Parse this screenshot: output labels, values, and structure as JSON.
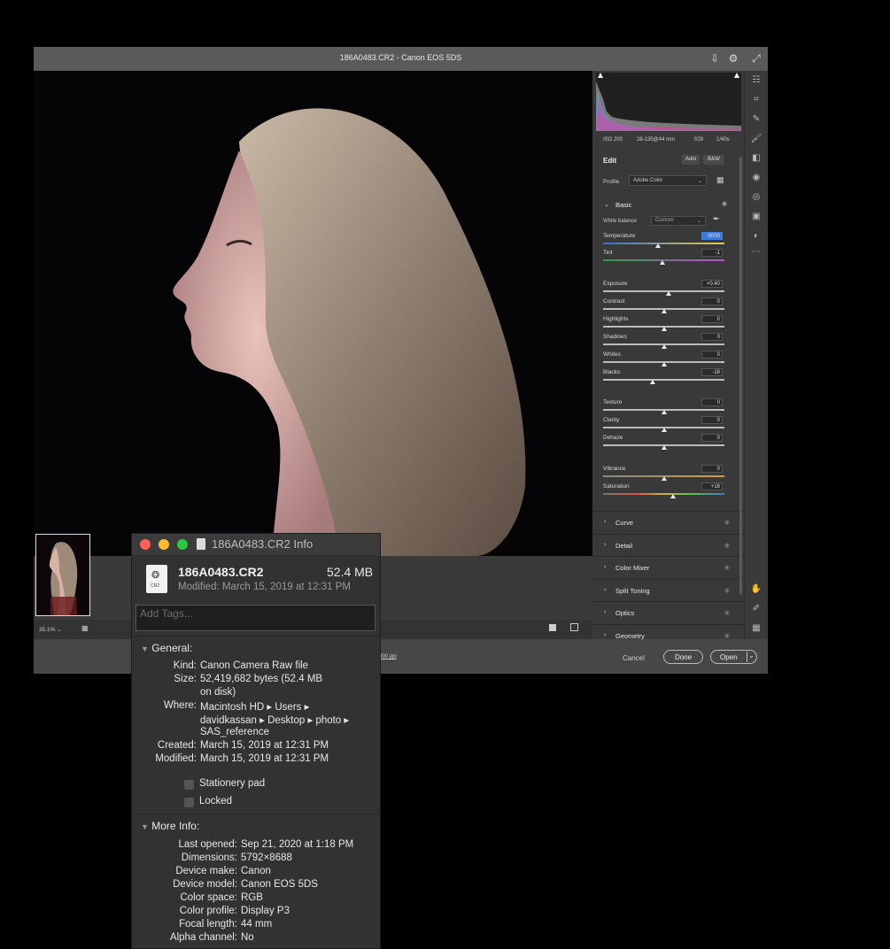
{
  "acr": {
    "title": "186A0483.CR2  -  Canon EOS 5DS",
    "icons": [
      "save-icon",
      "gear-icon",
      "fullscreen-icon"
    ],
    "meta": [
      "ISO 200",
      "28-135@44 mm",
      "f/29",
      "1/40s"
    ],
    "edit_label": "Edit",
    "auto_label": "Auto",
    "bw_label": "B&W",
    "profile_label": "Profile",
    "profile_value": "Adobe Color",
    "basic_label": "Basic",
    "wb_label": "White balance",
    "wb_value": "Custom",
    "sliders": [
      {
        "label": "Temperature",
        "value": "6000",
        "level": 0.45
      },
      {
        "label": "Tint",
        "value": "-1",
        "level": 0.49
      },
      {
        "label": "Exposure",
        "value": "+0.40",
        "level": 0.54
      },
      {
        "label": "Contrast",
        "value": "0",
        "level": 0.5
      },
      {
        "label": "Highlights",
        "value": "0",
        "level": 0.5
      },
      {
        "label": "Shadows",
        "value": "0",
        "level": 0.5
      },
      {
        "label": "Whites",
        "value": "0",
        "level": 0.5
      },
      {
        "label": "Blacks",
        "value": "-18",
        "level": 0.41
      },
      {
        "label": "Texture",
        "value": "0",
        "level": 0.5
      },
      {
        "label": "Clarity",
        "value": "0",
        "level": 0.5
      },
      {
        "label": "Dehaze",
        "value": "0",
        "level": 0.5
      },
      {
        "label": "Vibrance",
        "value": "0",
        "level": 0.5
      },
      {
        "label": "Saturation",
        "value": "+16",
        "level": 0.58
      }
    ],
    "sections": [
      "Curve",
      "Detail",
      "Color Mixer",
      "Split Toning",
      "Optics",
      "Geometry"
    ],
    "zoom": "35.1%",
    "workflow_link": "300 ppi",
    "cancel_label": "Cancel",
    "done_label": "Done",
    "open_label": "Open"
  },
  "info": {
    "title": "186A0483.CR2 Info",
    "file_name": "186A0483.CR2",
    "file_size": "52.4 MB",
    "modified_line": "Modified: March 15, 2019 at 12:31 PM",
    "tags_placeholder": "Add Tags...",
    "file_badge": "CR2",
    "general_label": "General:",
    "general": [
      {
        "k": "Kind:",
        "v": "Canon Camera Raw file"
      },
      {
        "k": "Size:",
        "v": "52,419,682 bytes (52.4 MB"
      },
      {
        "k": "",
        "v": "on disk)"
      },
      {
        "k": "Where:",
        "v": "Macintosh HD ▸ Users ▸"
      },
      {
        "k": "",
        "v": "davidkassan ▸ Desktop ▸ photo ▸"
      },
      {
        "k": "",
        "v": "SAS_reference"
      },
      {
        "k": "Created:",
        "v": "March 15, 2019 at 12:31 PM"
      },
      {
        "k": "Modified:",
        "v": "March 15, 2019 at 12:31 PM"
      }
    ],
    "stationery_label": "Stationery pad",
    "locked_label": "Locked",
    "more_label": "More Info:",
    "more": [
      {
        "k": "Last opened:",
        "v": "Sep 21, 2020 at 1:18 PM"
      },
      {
        "k": "Dimensions:",
        "v": "5792×8688"
      },
      {
        "k": "Device make:",
        "v": "Canon"
      },
      {
        "k": "Device model:",
        "v": "Canon EOS 5DS"
      },
      {
        "k": "Color space:",
        "v": "RGB"
      },
      {
        "k": "Color profile:",
        "v": "Display P3"
      },
      {
        "k": "Focal length:",
        "v": "44 mm"
      },
      {
        "k": "Alpha channel:",
        "v": "No"
      }
    ]
  }
}
